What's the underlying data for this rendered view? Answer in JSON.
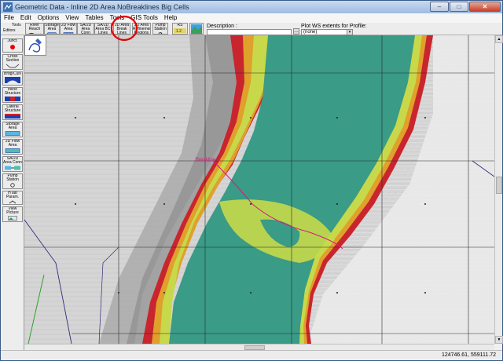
{
  "window": {
    "title": "Geometric Data - Inline 2D Area NoBreaklines Big Cells",
    "min_label": "–",
    "max_label": "□",
    "close_label": "✕"
  },
  "menu": [
    "File",
    "Edit",
    "Options",
    "View",
    "Tables",
    "Tools",
    "GIS Tools",
    "Help"
  ],
  "toolbar": {
    "tools_label": "Tools",
    "editors_label": "Editors",
    "buttons": [
      {
        "label": "River Reach"
      },
      {
        "label": "Storage Area"
      },
      {
        "label": "2D Flow Area"
      },
      {
        "label": "SA/2D Area Conn"
      },
      {
        "label": "SA/2D Area BC Lines"
      },
      {
        "label": "2D Area Break Lines"
      },
      {
        "label": "2D Area Refinement Regions"
      },
      {
        "label": "Pump Station"
      },
      {
        "label": "RS"
      },
      {
        "label": ""
      }
    ],
    "description_label": "Description :",
    "plot_ws_label": "Plot WS extents for Profile:",
    "plot_ws_value": "(none)"
  },
  "left_tools": [
    {
      "label": "Junct."
    },
    {
      "label": "Cross Section"
    },
    {
      "label": "Brdg/Culv"
    },
    {
      "label": "Inline Structure"
    },
    {
      "label": "Lateral Structure"
    },
    {
      "label": "Storage Area"
    },
    {
      "label": "2D Flow Area"
    },
    {
      "label": "SA/2D Area Conn"
    },
    {
      "label": "Pump Station"
    },
    {
      "label": "HTab Param."
    },
    {
      "label": "View Picture"
    }
  ],
  "map": {
    "breakline_label": "Breakline 1",
    "colors": {
      "terrain": "#d5d5d5",
      "deep_water": "#3a9b86",
      "shallow": "#c7d94a",
      "warm": "#e0a02c",
      "hot": "#c9252e",
      "highlight": "#e00000",
      "breakline": "#d7197b"
    }
  },
  "status": {
    "coordinates": "124746.61, 559111.72"
  },
  "icons": [
    "app-icon",
    "pencil-icon",
    "river-icon",
    "storage-icon",
    "flow-area-icon",
    "connection-icon",
    "bc-line-icon",
    "breakline-icon",
    "refinement-icon",
    "pump-icon",
    "rs-icon",
    "background-map-icon"
  ]
}
